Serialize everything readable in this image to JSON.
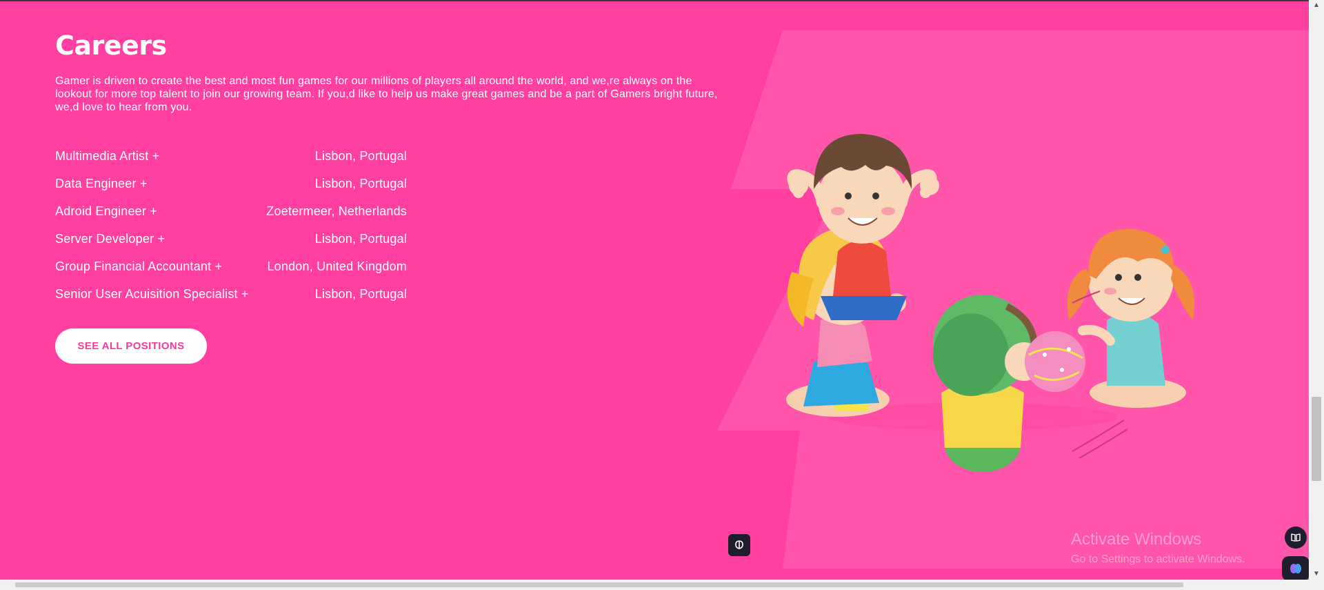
{
  "careers": {
    "title": "Careers",
    "intro": "Gamer is driven to create the best and most fun games for our millions of players all around the world, and we,re always on the lookout for more top talent to join our growing team. If you,d like to help us make great games and be a part of Gamers bright future, we,d love to hear from you.",
    "jobs": [
      {
        "title": "Multimedia Artist +",
        "location": "Lisbon, Portugal"
      },
      {
        "title": "Data Engineer +",
        "location": "Lisbon, Portugal"
      },
      {
        "title": "Adroid Engineer +",
        "location": "Zoetermeer, Netherlands"
      },
      {
        "title": "Server Developer +",
        "location": "Lisbon, Portugal"
      },
      {
        "title": "Group Financial Accountant +",
        "location": "London, United Kingdom"
      },
      {
        "title": "Senior User Acuisition Specialist +",
        "location": "Lisbon, Portugal"
      }
    ],
    "cta_label": "SEE ALL POSITIONS"
  },
  "watermark": {
    "title": "Activate Windows",
    "subtitle": "Go to Settings to activate Windows."
  },
  "colors": {
    "background": "#ff40a0",
    "panel": "#ff55aa",
    "button_text": "#f03a9c"
  },
  "icons": {
    "illustration": "children-playing-illustration",
    "extension_floating": "brain-icon",
    "extension_reader": "book-icon"
  }
}
